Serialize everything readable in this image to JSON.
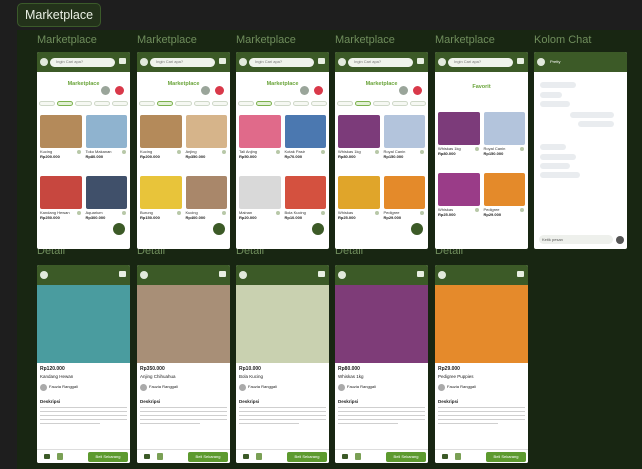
{
  "page_badge": "Marketplace",
  "frame_labels_top": [
    "Marketplace",
    "Marketplace",
    "Marketplace",
    "Marketplace",
    "Marketplace",
    "Kolom Chat"
  ],
  "frame_labels_bottom": [
    "Detail",
    "Detail",
    "Detail",
    "Detail",
    "Detail"
  ],
  "search_placeholder": "Ingin Cari apa?",
  "screens": [
    {
      "title": "Marketplace",
      "cards": [
        {
          "name": "Kucing",
          "price": "Rp200.000",
          "color": "#b48a5a"
        },
        {
          "name": "Toko Makanan",
          "price": "Rp80.000",
          "color": "#8fb3cf"
        },
        {
          "name": "Kandang Hewan",
          "price": "Rp250.000",
          "color": "#c7473f"
        },
        {
          "name": "Aquarium",
          "price": "Rp300.000",
          "color": "#40506a"
        }
      ]
    },
    {
      "title": "Marketplace",
      "cards": [
        {
          "name": "Kucing",
          "price": "Rp200.000",
          "color": "#b48a5a"
        },
        {
          "name": "Anjing",
          "price": "Rp350.000",
          "color": "#d6b48a"
        },
        {
          "name": "Burung",
          "price": "Rp150.000",
          "color": "#e8c43a"
        },
        {
          "name": "Kucing",
          "price": "Rp400.000",
          "color": "#a9876a"
        }
      ]
    },
    {
      "title": "Marketplace",
      "cards": [
        {
          "name": "Tali Anjing",
          "price": "Rp50.000",
          "color": "#e06a8a"
        },
        {
          "name": "Kotak Pasir",
          "price": "Rp70.000",
          "color": "#4b78b0"
        },
        {
          "name": "Mainan",
          "price": "Rp20.000",
          "color": "#d9d9d9"
        },
        {
          "name": "Bola Kucing",
          "price": "Rp10.000",
          "color": "#d4513f"
        }
      ]
    },
    {
      "title": "Marketplace",
      "cards": [
        {
          "name": "Whiskas 1kg",
          "price": "Rp80.000",
          "color": "#7c3b7a"
        },
        {
          "name": "Royal Canin",
          "price": "Rp150.000",
          "color": "#b3c4dc"
        },
        {
          "name": "Whiskas",
          "price": "Rp25.000",
          "color": "#e0a52a"
        },
        {
          "name": "Pedigree",
          "price": "Rp29.000",
          "color": "#e48a2a"
        }
      ]
    },
    {
      "title": "Favorit",
      "cards": [
        {
          "name": "Whiskas 1kg",
          "price": "Rp80.000",
          "color": "#7c3b7a"
        },
        {
          "name": "Royal Canin",
          "price": "Rp150.000",
          "color": "#b3c4dc"
        },
        {
          "name": "Whiskas",
          "price": "Rp25.000",
          "color": "#9a3c88"
        },
        {
          "name": "Pedigree",
          "price": "Rp29.000",
          "color": "#e48a2a"
        }
      ]
    }
  ],
  "chat": {
    "name": "Pretty",
    "input_placeholder": "Ketik pesan"
  },
  "details": [
    {
      "price": "Rp120.000",
      "name": "Kandang Hewan",
      "color": "#4a9c9f"
    },
    {
      "price": "Rp350.000",
      "name": "Anjing Chihuahua",
      "color": "#a88f77"
    },
    {
      "price": "Rp10.000",
      "name": "Bola Kucing",
      "color": "#c9d1b0"
    },
    {
      "price": "Rp80.000",
      "name": "Whiskas 1kg",
      "color": "#7e3c78"
    },
    {
      "price": "Rp29.000",
      "name": "Pedigree Puppies",
      "color": "#e58a2b"
    }
  ],
  "detail_section": "Deskripsi",
  "seller": "Fauzia Ranggali",
  "buy_label": "Beli Sekarang"
}
